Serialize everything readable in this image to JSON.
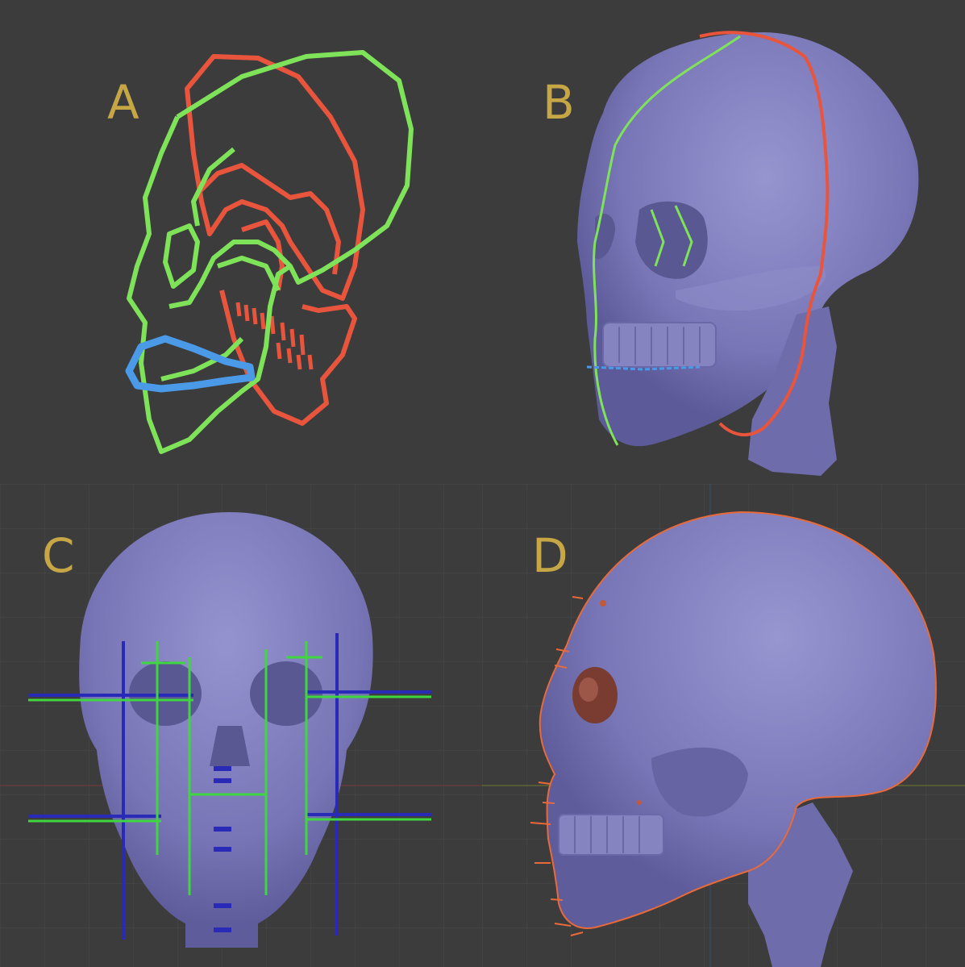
{
  "panels": {
    "a": {
      "label": "A"
    },
    "b": {
      "label": "B"
    },
    "c": {
      "label": "C"
    },
    "d": {
      "label": "D"
    }
  },
  "colors": {
    "background": "#3c3c3d",
    "label": "#c7a645",
    "skull": "#7a78b8",
    "skull_shadow": "#5b5a94",
    "skull_highlight": "#a3a2d8",
    "outline_green": "#7fe35a",
    "outline_red": "#e8553c",
    "outline_blue": "#4b9ae8",
    "guide_blue": "#2a2ab8",
    "guide_green": "#3fd63f",
    "contour_orange": "#e86a3a",
    "grid": "#4a4a4b"
  }
}
